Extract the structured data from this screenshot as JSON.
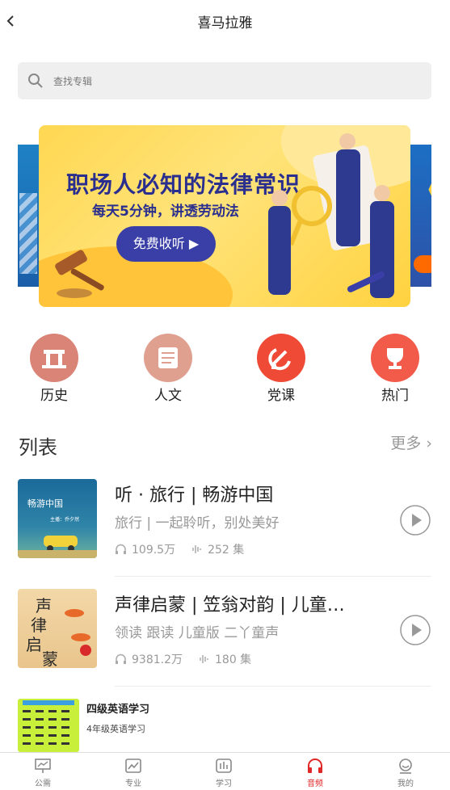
{
  "header": {
    "title": "喜马拉雅"
  },
  "search": {
    "placeholder": "查找专辑"
  },
  "banner": {
    "headline": "职场人必知的法律常识",
    "subline": "每天5分钟，讲透劳动法",
    "button_label": "免费收听"
  },
  "categories": [
    {
      "label": "历史",
      "color": "#d98476",
      "icon": "history-icon"
    },
    {
      "label": "人文",
      "color": "#e0a090",
      "icon": "humanities-icon"
    },
    {
      "label": "党课",
      "color": "#ef4a36",
      "icon": "party-emblem-icon"
    },
    {
      "label": "热门",
      "color": "#f25a4a",
      "icon": "trophy-icon"
    }
  ],
  "list": {
    "title": "列表",
    "more_label": "更多",
    "items": [
      {
        "title": "听 · 旅行 | 畅游中国",
        "subtitle": "旅行 | 一起聆听，别处美好",
        "plays": "109.5万",
        "episodes": "252 集",
        "cover_title": "畅游中国",
        "cover_host": "主播：乔夕然"
      },
      {
        "title": "声律启蒙 | 笠翁对韵 | 儿童…",
        "subtitle": "领读 跟读 儿童版 二丫童声",
        "plays": "9381.2万",
        "episodes": "180 集",
        "cover_title": "声律启蒙"
      },
      {
        "title": "四级英语学习",
        "subtitle": "4年级英语学习"
      }
    ]
  },
  "tabbar": {
    "items": [
      {
        "label": "公需",
        "icon": "presentation-icon",
        "active": false
      },
      {
        "label": "专业",
        "icon": "chart-icon",
        "active": false
      },
      {
        "label": "学习",
        "icon": "study-icon",
        "active": false
      },
      {
        "label": "音频",
        "icon": "headphones-icon",
        "active": true
      },
      {
        "label": "我的",
        "icon": "profile-icon",
        "active": false
      }
    ],
    "active_color": "#e02828"
  }
}
